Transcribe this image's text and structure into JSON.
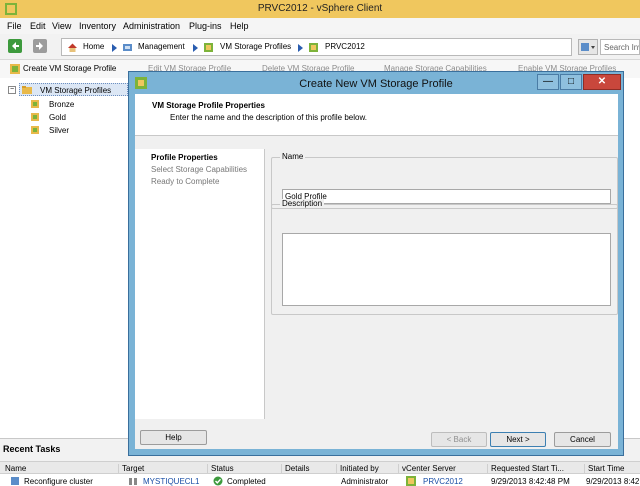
{
  "window": {
    "title": "PRVC2012 - vSphere Client"
  },
  "menu": [
    "File",
    "Edit",
    "View",
    "Inventory",
    "Administration",
    "Plug-ins",
    "Help"
  ],
  "breadcrumb": [
    "Home",
    "Management",
    "VM Storage Profiles",
    "PRVC2012"
  ],
  "search": {
    "placeholder": "Search Inv"
  },
  "toolbar": {
    "create": "Create VM Storage Profile",
    "edit": "Edit VM Storage Profile",
    "delete": "Delete VM Storage Profile",
    "manage": "Manage Storage Capabilities",
    "enable": "Enable VM Storage Profiles"
  },
  "tree": {
    "root": "VM Storage Profiles",
    "items": [
      "Bronze",
      "Gold",
      "Silver"
    ]
  },
  "recent_tasks": {
    "title": "Recent Tasks",
    "columns": [
      "Name",
      "Target",
      "Status",
      "Details",
      "Initiated by",
      "vCenter Server",
      "Requested Start Ti...",
      "Start Time"
    ],
    "rows": [
      {
        "name": "Reconfigure cluster",
        "target": "MYSTIQUECL1",
        "status": "Completed",
        "details": "",
        "initiated_by": "Administrator",
        "vcenter": "PRVC2012",
        "requested": "9/29/2013 8:42:48 PM",
        "start": "9/29/2013 8:42"
      }
    ]
  },
  "dialog": {
    "title": "Create New VM Storage Profile",
    "header_title": "VM Storage Profile Properties",
    "header_subtitle": "Enter the name and the description of this profile below.",
    "steps": [
      "Profile Properties",
      "Select Storage Capabilities",
      "Ready to Complete"
    ],
    "name_label": "Name",
    "name_value": "Gold Profile",
    "description_label": "Description",
    "description_value": "",
    "buttons": {
      "help": "Help",
      "back": "< Back",
      "next": "Next >",
      "cancel": "Cancel"
    },
    "window_buttons": {
      "minimize": "—",
      "maximize": "□",
      "close": "✕"
    }
  },
  "colors": {
    "dialog_frame": "#7ab3d6",
    "titlebar": "#f0c75e",
    "link": "#1a4fa6"
  }
}
